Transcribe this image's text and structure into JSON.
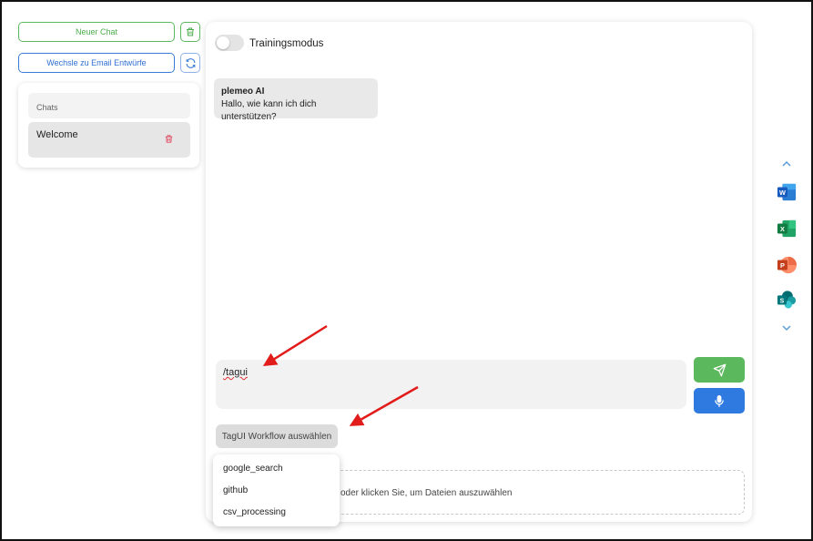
{
  "sidebar": {
    "new_chat_label": "Neuer Chat",
    "switch_label": "Wechsle zu Email Entwürfe",
    "chats_header": "Chats",
    "chat_items": [
      {
        "label": "Welcome"
      }
    ]
  },
  "main": {
    "training_toggle": {
      "label": "Trainingsmodus",
      "enabled": false
    },
    "messages": [
      {
        "sender": "plemeo AI",
        "text": "Hallo, wie kann ich dich unterstützen?"
      }
    ],
    "input": {
      "value": "/tagui"
    },
    "workflow_button_label": "TagUI Workflow auswählen",
    "workflow_options": [
      "google_search",
      "github",
      "csv_processing"
    ],
    "dropzone_text": "oder klicken Sie, um Dateien auszuwählen"
  },
  "rail": {
    "apps": [
      "word-icon",
      "excel-icon",
      "powerpoint-icon",
      "sharepoint-icon"
    ]
  },
  "colors": {
    "green": "#5cb85c",
    "blue": "#2f7ae0",
    "annotation_red": "#e21b1b"
  }
}
